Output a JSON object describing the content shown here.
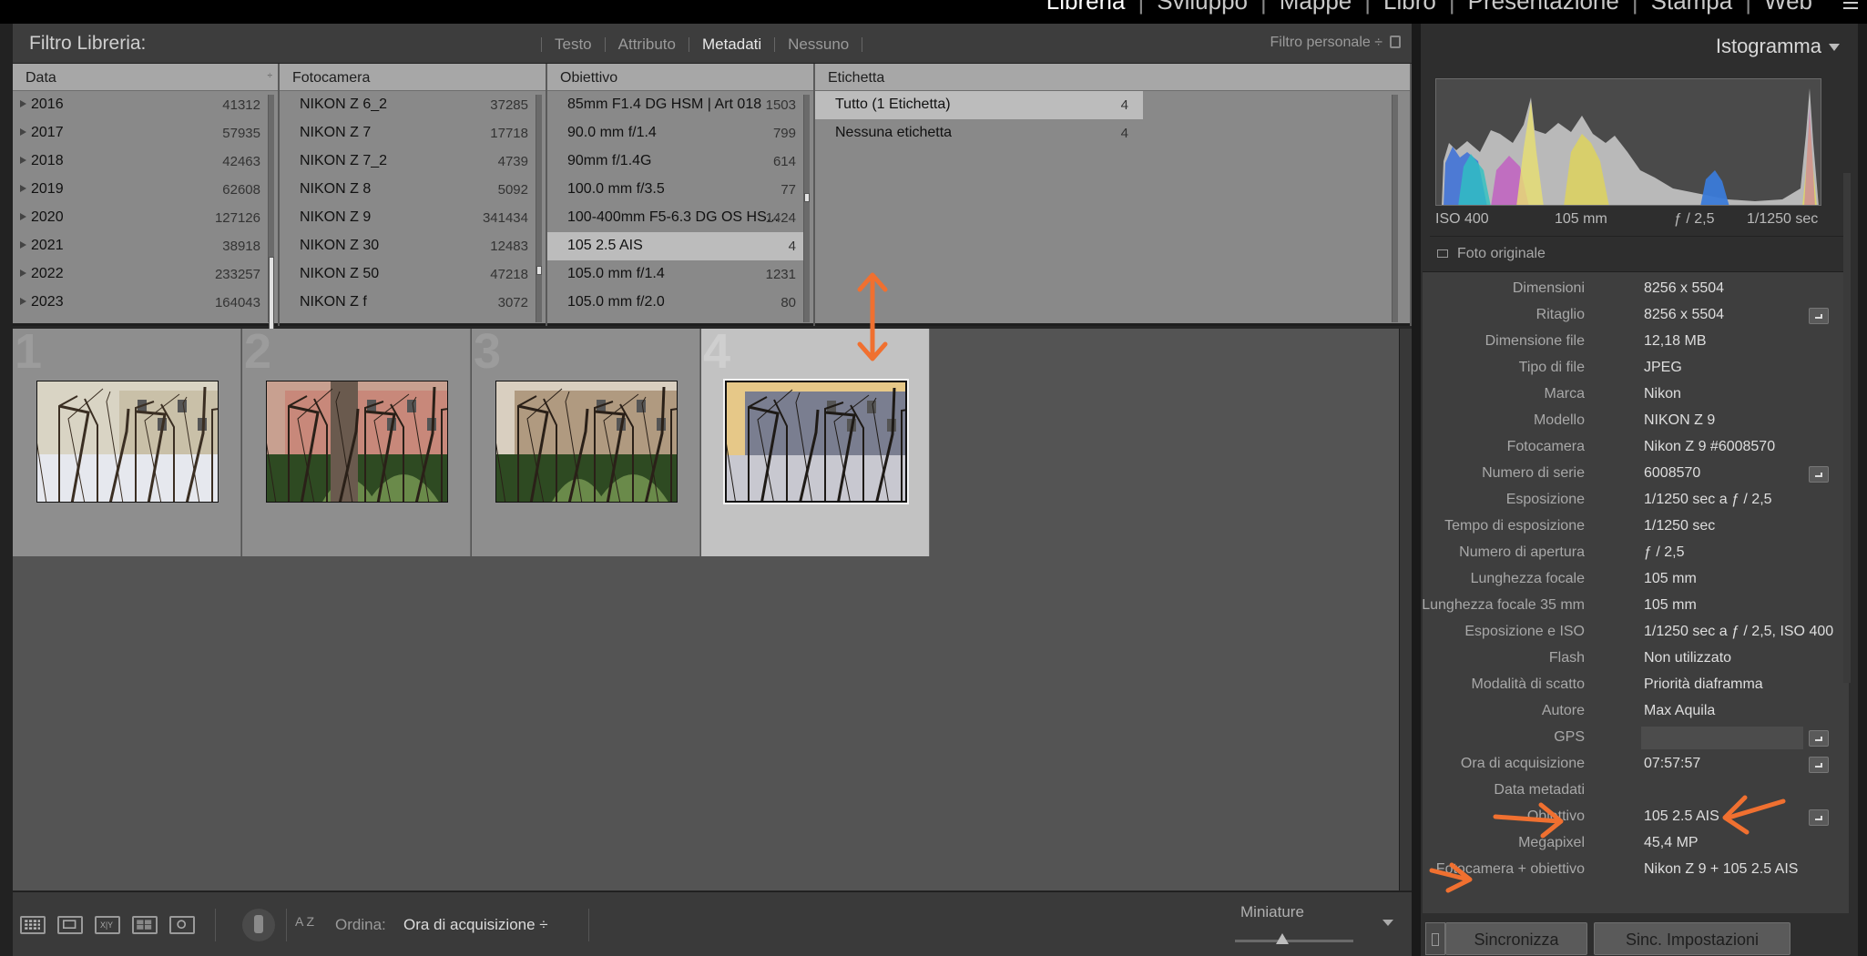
{
  "modules": {
    "items": [
      "Libreria",
      "Sviluppo",
      "Mappe",
      "Libro",
      "Presentazione",
      "Stampa",
      "Web"
    ]
  },
  "filter_bar": {
    "title": "Filtro Libreria:",
    "tabs": [
      "Testo",
      "Attributo",
      "Metadati",
      "Nessuno"
    ],
    "active_tab": "Metadati",
    "preset": "Filtro personale ÷"
  },
  "columns": {
    "data": {
      "header": "Data",
      "rows": [
        {
          "label": "2016",
          "count": "41312"
        },
        {
          "label": "2017",
          "count": "57935"
        },
        {
          "label": "2018",
          "count": "42463"
        },
        {
          "label": "2019",
          "count": "62608"
        },
        {
          "label": "2020",
          "count": "127126"
        },
        {
          "label": "2021",
          "count": "38918"
        },
        {
          "label": "2022",
          "count": "233257"
        },
        {
          "label": "2023",
          "count": "164043"
        }
      ]
    },
    "fotocamera": {
      "header": "Fotocamera",
      "rows": [
        {
          "label": "NIKON Z 6_2",
          "count": "37285"
        },
        {
          "label": "NIKON Z 7",
          "count": "17718"
        },
        {
          "label": "NIKON Z 7_2",
          "count": "4739"
        },
        {
          "label": "NIKON Z 8",
          "count": "5092"
        },
        {
          "label": "NIKON Z 9",
          "count": "341434"
        },
        {
          "label": "NIKON Z 30",
          "count": "12483"
        },
        {
          "label": "NIKON Z 50",
          "count": "47218"
        },
        {
          "label": "NIKON Z f",
          "count": "3072"
        }
      ]
    },
    "obiettivo": {
      "header": "Obiettivo",
      "rows": [
        {
          "label": "85mm F1.4 DG HSM | Art 018",
          "count": "1503"
        },
        {
          "label": "90.0 mm f/1.4",
          "count": "799"
        },
        {
          "label": "90mm f/1.4G",
          "count": "614"
        },
        {
          "label": "100.0 mm f/3.5",
          "count": "77"
        },
        {
          "label": "100-400mm F5-6.3 DG OS HS...",
          "count": "1424"
        },
        {
          "label": "105 2.5 AIS",
          "count": "4"
        },
        {
          "label": "105.0 mm f/1.4",
          "count": "1231"
        },
        {
          "label": "105.0 mm f/2.0",
          "count": "80"
        }
      ],
      "selected": "105 2.5 AIS"
    },
    "etichetta": {
      "header": "Etichetta",
      "rows": [
        {
          "label": "Tutto (1 Etichetta)",
          "count": "4"
        },
        {
          "label": "Nessuna etichetta",
          "count": "4"
        }
      ],
      "selected": "Tutto (1 Etichetta)"
    }
  },
  "grid": {
    "cells": [
      {
        "num": "1"
      },
      {
        "num": "2"
      },
      {
        "num": "3"
      },
      {
        "num": "4"
      }
    ],
    "selected": "4"
  },
  "toolbar": {
    "az_label": "A Z",
    "sort_label": "Ordina:",
    "sort_value": "Ora di acquisizione ÷",
    "thumbs_label": "Miniature",
    "thumb_size_fraction": 0.4
  },
  "right_panel": {
    "title": "Istogramma",
    "hist_info": {
      "iso": "ISO 400",
      "focal": "105 mm",
      "aperture": "ƒ / 2,5",
      "shutter": "1/1250 sec"
    },
    "original_label": "Foto originale",
    "metadata": [
      {
        "k": "Dimensioni",
        "v": "8256 x 5504",
        "btn": false
      },
      {
        "k": "Ritaglio",
        "v": "8256 x 5504",
        "btn": true
      },
      {
        "k": "Dimensione file",
        "v": "12,18 MB",
        "btn": false
      },
      {
        "k": "Tipo di file",
        "v": "JPEG",
        "btn": false
      },
      {
        "k": "Marca",
        "v": "Nikon",
        "btn": false
      },
      {
        "k": "Modello",
        "v": "NIKON Z 9",
        "btn": false
      },
      {
        "k": "Fotocamera",
        "v": "Nikon Z 9 #6008570",
        "btn": false
      },
      {
        "k": "Numero di serie",
        "v": "6008570",
        "btn": true
      },
      {
        "k": "Esposizione",
        "v": "1/1250 sec a ƒ / 2,5",
        "btn": false
      },
      {
        "k": "Tempo di esposizione",
        "v": "1/1250 sec",
        "btn": false
      },
      {
        "k": "Numero di apertura",
        "v": "ƒ / 2,5",
        "btn": false
      },
      {
        "k": "Lunghezza focale",
        "v": "105 mm",
        "btn": false
      },
      {
        "k": "Lunghezza focale 35 mm",
        "v": "105 mm",
        "btn": false
      },
      {
        "k": "Esposizione e ISO",
        "v": "1/1250 sec a ƒ / 2,5, ISO 400",
        "btn": false
      },
      {
        "k": "Flash",
        "v": "Non utilizzato",
        "btn": false
      },
      {
        "k": "Modalità di scatto",
        "v": "Priorità diaframma",
        "btn": false
      },
      {
        "k": "Autore",
        "v": "Max Aquila",
        "btn": false
      },
      {
        "k": "GPS",
        "v": "",
        "btn": true
      },
      {
        "k": "Ora di acquisizione",
        "v": "07:57:57",
        "btn": true
      },
      {
        "k": "Data metadati",
        "v": "",
        "btn": false
      },
      {
        "k": "Obiettivo",
        "v": "105 2.5 AIS",
        "btn": true
      },
      {
        "k": "Megapixel",
        "v": "45,4 MP",
        "btn": false
      },
      {
        "k": "Fotocamera + obiettivo",
        "v": "Nikon Z 9 + 105 2.5 AIS",
        "btn": false
      }
    ],
    "sync_label": "Sincronizza",
    "sync_settings_label": "Sinc. Impostazioni"
  },
  "colors": {
    "annotation": "#f07030",
    "selected_row": "#bcbcbc"
  }
}
